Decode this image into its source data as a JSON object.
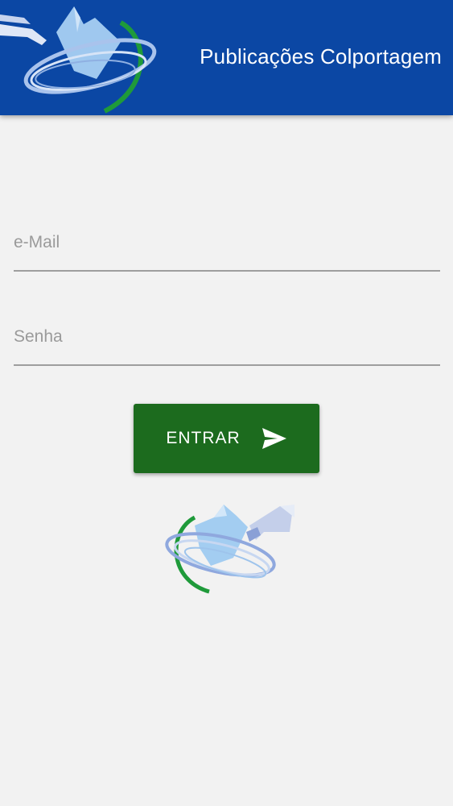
{
  "app_bar": {
    "title": "Publicações Colportagem",
    "background_color": "#0b47a4",
    "logo_icon": "globe-book-logo-icon"
  },
  "form": {
    "email": {
      "placeholder": "e-Mail",
      "value": ""
    },
    "password": {
      "placeholder": "Senha",
      "value": ""
    },
    "submit": {
      "label": "ENTRAR",
      "icon": "send-icon",
      "color": "#1c6b1e"
    }
  },
  "footer_logo": {
    "icon": "globe-book-logo-icon"
  }
}
